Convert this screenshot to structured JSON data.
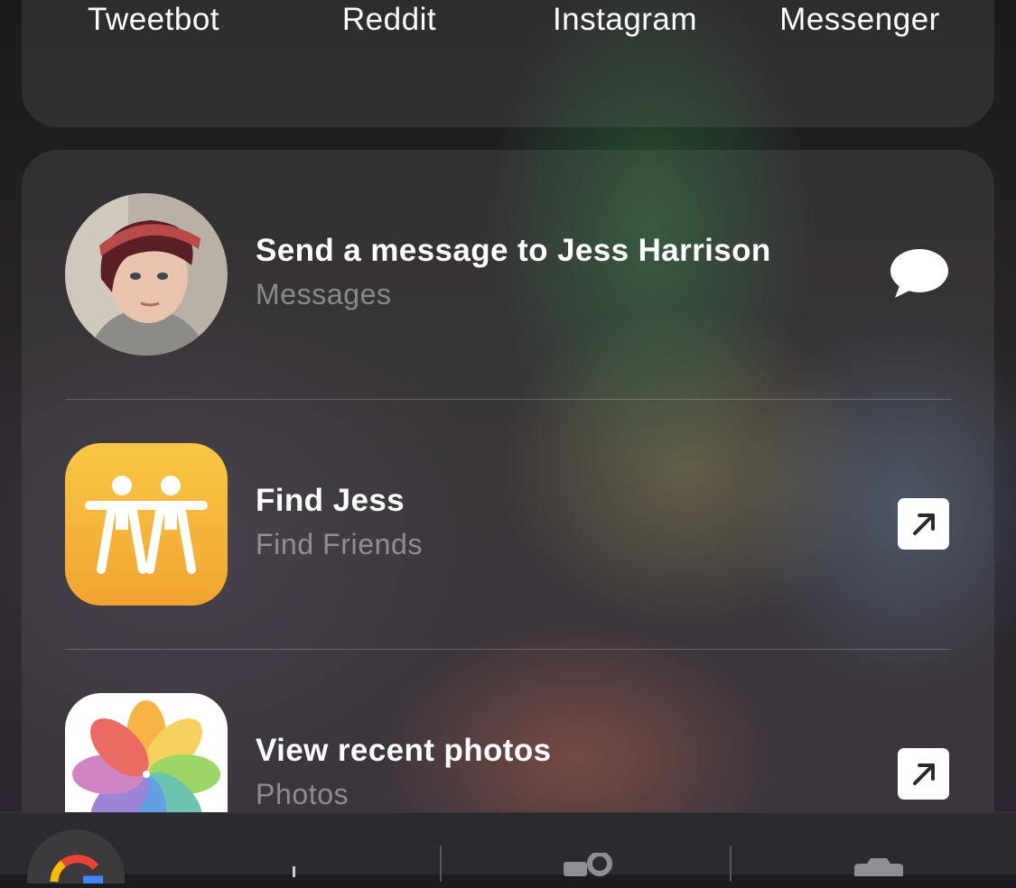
{
  "apps": [
    {
      "label": "Tweetbot",
      "icon": "tweetbot-icon"
    },
    {
      "label": "Reddit",
      "icon": "reddit-icon"
    },
    {
      "label": "Instagram",
      "icon": "instagram-icon"
    },
    {
      "label": "Messenger",
      "icon": "messenger-icon"
    }
  ],
  "suggestions": [
    {
      "title": "Send a message to Jess Harrison",
      "subtitle": "Messages",
      "action": "message-bubble-icon"
    },
    {
      "title": "Find Jess",
      "subtitle": "Find Friends",
      "action": "open-arrow-icon"
    },
    {
      "title": "View recent photos",
      "subtitle": "Photos",
      "action": "open-arrow-icon"
    }
  ],
  "dock": [
    "google-icon",
    "search-icon",
    "contacts-icon",
    "camera-icon"
  ],
  "colors": {
    "find_friends": "#f4b23a",
    "reddit": "#e8422a",
    "messenger": "#2f7bf5",
    "tweetbot": "#3b8ef0"
  }
}
